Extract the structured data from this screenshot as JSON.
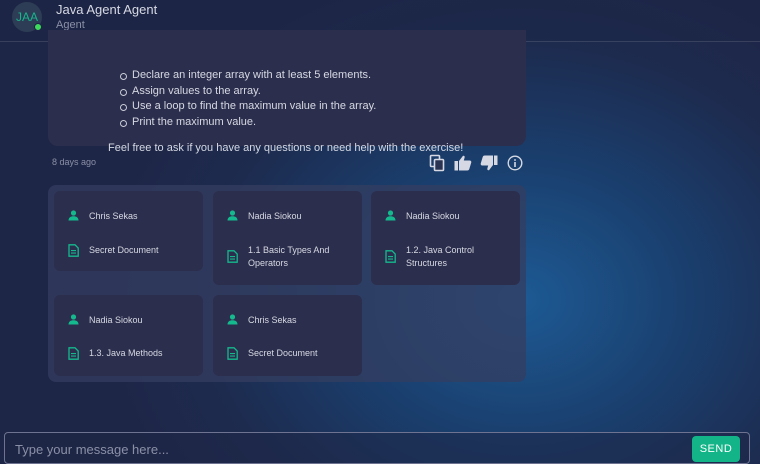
{
  "header": {
    "avatar_initials": "JAA",
    "agent_name": "Java Agent Agent",
    "agent_role": "Agent",
    "status_color": "#3ddc5a"
  },
  "message": {
    "list_items": [
      "Declare an integer array with at least 5 elements.",
      "Assign values to the array.",
      "Use a loop to find the maximum value in the array.",
      "Print the maximum value."
    ],
    "closing": "Feel free to ask if you have any questions or need help with the exercise!",
    "timestamp": "8 days ago"
  },
  "actions": [
    "copy-icon",
    "thumbs-up-icon",
    "thumbs-down-icon",
    "info-icon"
  ],
  "sources": [
    {
      "author": "Chris Sekas",
      "document": "Secret Document"
    },
    {
      "author": "Nadia Siokou",
      "document": "1.1 Basic Types And Operators"
    },
    {
      "author": "Nadia Siokou",
      "document": "1.2. Java Control Structures"
    },
    {
      "author": "Nadia Siokou",
      "document": "1.3. Java Methods"
    },
    {
      "author": "Chris Sekas",
      "document": "Secret Document"
    }
  ],
  "composer": {
    "placeholder": "Type your message here...",
    "send_label": "SEND"
  },
  "colors": {
    "accent": "#12b488",
    "card": "#2c2e4d",
    "panel": "#343e60"
  }
}
